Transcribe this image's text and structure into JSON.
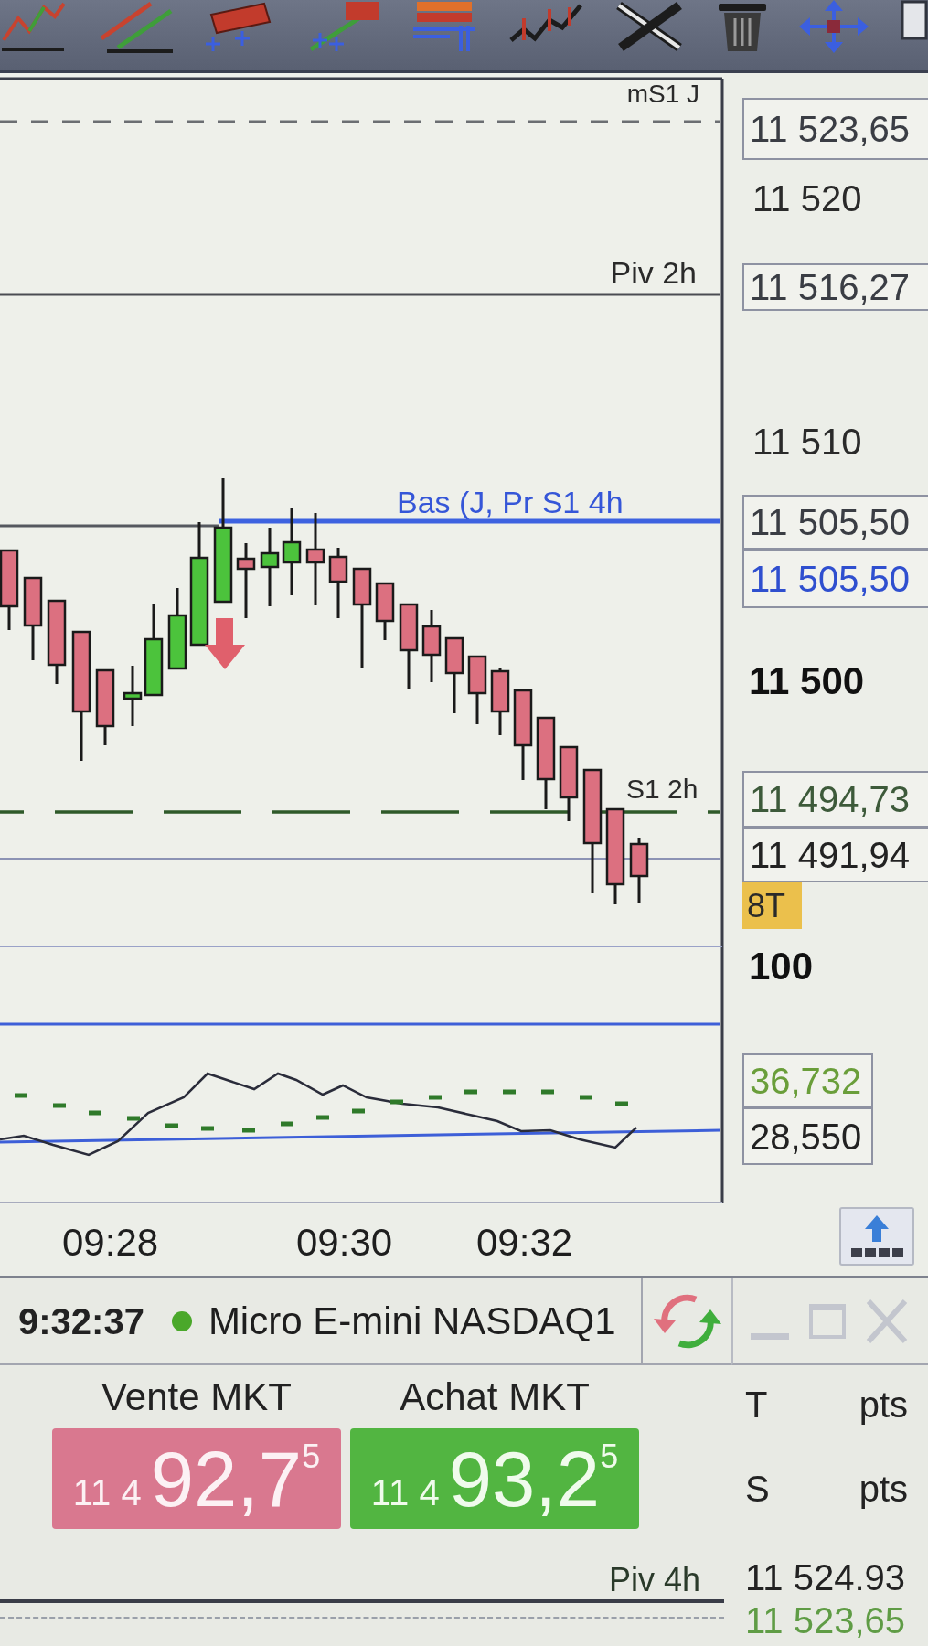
{
  "chart": {
    "level_lines": [
      {
        "label": "mS1 J",
        "kind": "dashed"
      },
      {
        "label": "Piv 2h",
        "kind": "solid"
      },
      {
        "label": "Bas (J, Pr S1 4h",
        "kind": "support"
      },
      {
        "label": "S1 2h",
        "kind": "longdash"
      }
    ],
    "price_axis": [
      {
        "text": "11 523,65",
        "kind": "box",
        "color": "#3a3d44"
      },
      {
        "text": "11 520",
        "kind": "tick",
        "color": "#2a2a2a"
      },
      {
        "text": "11 516,27",
        "kind": "box",
        "color": "#3a3d44"
      },
      {
        "text": "11 510",
        "kind": "tick",
        "color": "#2a2a2a"
      },
      {
        "text": "11 505,50",
        "kind": "box",
        "color": "#3a3d44"
      },
      {
        "text": "11 505,50",
        "kind": "box",
        "color": "#2f4fcf"
      },
      {
        "text": "11 500",
        "kind": "major",
        "color": "#111111"
      },
      {
        "text": "11 494,73",
        "kind": "box",
        "color": "#3d5a3a"
      },
      {
        "text": "11 491,94",
        "kind": "box",
        "color": "#222222"
      },
      {
        "text": "8T",
        "kind": "tag"
      },
      {
        "text": "100",
        "kind": "major",
        "color": "#111111"
      }
    ],
    "indicator_axis": [
      {
        "text": "36,732",
        "kind": "box",
        "color": "#6a9e3a"
      },
      {
        "text": "28,550",
        "kind": "box",
        "color": "#222222"
      }
    ],
    "time_axis": [
      "09:28",
      "09:30",
      "09:32"
    ]
  },
  "order_ticket": {
    "time": "9:32:37",
    "instrument": "Micro E-mini NASDAQ1",
    "sell": {
      "label": "Vente MKT",
      "price_prefix": "11 4",
      "price": "92,7$^{5}$"
    },
    "buy": {
      "label": "Achat MKT",
      "price_prefix": "11 4",
      "price": "93,2$^{5}$"
    },
    "stats": [
      {
        "label": "T",
        "unit": "pts"
      },
      {
        "label": "S",
        "unit": "pts"
      }
    ]
  },
  "lower_chart": {
    "level_label": "Piv 4h",
    "price_axis": [
      {
        "text": "11 524.93",
        "color": "#222222"
      },
      {
        "text": "11 523,65",
        "color": "#5f9c45"
      }
    ]
  }
}
